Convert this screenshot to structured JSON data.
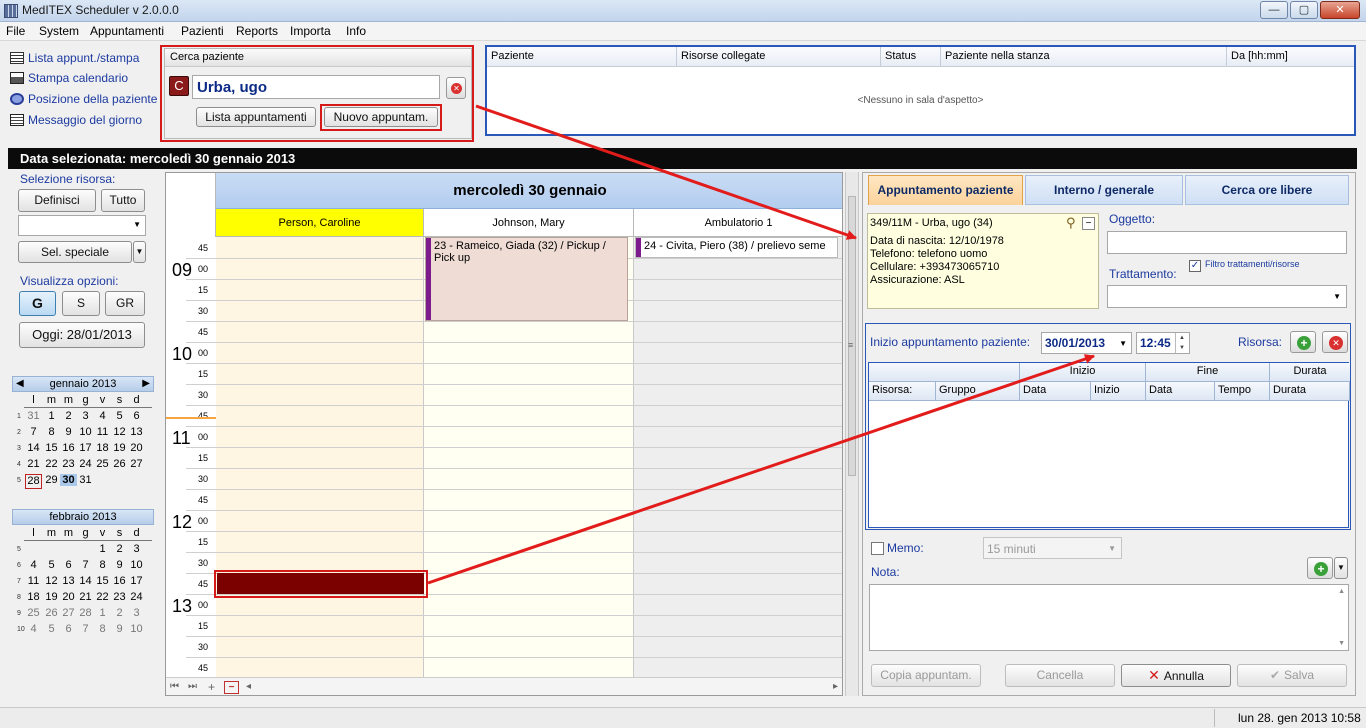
{
  "window": {
    "title": "MedITEX  Scheduler v 2.0.0.0",
    "min": "—",
    "max": "▢",
    "close": "✕"
  },
  "menu": [
    "File",
    "System",
    "Appuntamenti",
    "Pazienti",
    "Reports",
    "Importa",
    "Info"
  ],
  "quick_actions": [
    {
      "label": "Lista appunt./stampa",
      "icon": "list-icon"
    },
    {
      "label": "Stampa calendario",
      "icon": "printer-icon"
    },
    {
      "label": "Posizione della paziente",
      "icon": "position-icon"
    },
    {
      "label": "Messaggio del giorno",
      "icon": "message-icon"
    }
  ],
  "search": {
    "header": "Cerca paziente",
    "patient": "Urba, ugo",
    "btn_list": "Lista appuntamenti",
    "btn_new": "Nuovo appuntam."
  },
  "waiting": {
    "columns": [
      "Paziente",
      "Risorse collegate",
      "Status",
      "Paziente nella stanza",
      "Da [hh:mm]"
    ],
    "empty": "<Nessuno in sala d'aspetto>"
  },
  "date_banner": "Data selezionata: mercoledì 30 gennaio 2013",
  "left": {
    "selezione_risorsa": "Selezione risorsa:",
    "btn_definisci": "Definisci",
    "btn_tutto": "Tutto",
    "btn_sel_speciale": "Sel. speciale",
    "visualizza": "Visualizza opzioni:",
    "view_g": "G",
    "view_s": "S",
    "view_gr": "GR",
    "btn_oggi": "Oggi: 28/01/2013",
    "cal1": {
      "title": "gennaio 2013",
      "dow": [
        "l",
        "m",
        "m",
        "g",
        "v",
        "s",
        "d"
      ],
      "weeks": [
        {
          "wk": "1",
          "days": [
            "31",
            "1",
            "2",
            "3",
            "4",
            "5",
            "6"
          ]
        },
        {
          "wk": "2",
          "days": [
            "7",
            "8",
            "9",
            "10",
            "11",
            "12",
            "13"
          ]
        },
        {
          "wk": "3",
          "days": [
            "14",
            "15",
            "16",
            "17",
            "18",
            "19",
            "20"
          ]
        },
        {
          "wk": "4",
          "days": [
            "21",
            "22",
            "23",
            "24",
            "25",
            "26",
            "27"
          ]
        },
        {
          "wk": "5",
          "days": [
            "28",
            "29",
            "30",
            "31",
            "",
            "",
            ""
          ]
        }
      ]
    },
    "cal2": {
      "title": "febbraio 2013",
      "dow": [
        "l",
        "m",
        "m",
        "g",
        "v",
        "s",
        "d"
      ],
      "weeks": [
        {
          "wk": "5",
          "days": [
            "",
            "",
            "",
            "",
            "1",
            "2",
            "3"
          ]
        },
        {
          "wk": "6",
          "days": [
            "4",
            "5",
            "6",
            "7",
            "8",
            "9",
            "10"
          ]
        },
        {
          "wk": "7",
          "days": [
            "11",
            "12",
            "13",
            "14",
            "15",
            "16",
            "17"
          ]
        },
        {
          "wk": "8",
          "days": [
            "18",
            "19",
            "20",
            "21",
            "22",
            "23",
            "24"
          ]
        },
        {
          "wk": "9",
          "days": [
            "25",
            "26",
            "27",
            "28",
            "1",
            "2",
            "3"
          ]
        },
        {
          "wk": "10",
          "days": [
            "4",
            "5",
            "6",
            "7",
            "8",
            "9",
            "10"
          ]
        }
      ]
    }
  },
  "grid": {
    "day_title": "mercoledì 30 gennaio",
    "resources": [
      "Person, Caroline",
      "Johnson, Mary",
      "Ambulatorio 1"
    ],
    "hours": [
      "09",
      "10",
      "11",
      "12",
      "13"
    ],
    "mins": [
      "00",
      "15",
      "30",
      "45"
    ],
    "appts": [
      {
        "text": "23 - Rameico, Giada (32) / Pickup / Pick up"
      },
      {
        "text": "24 - Civita, Piero (38) / prelievo seme"
      }
    ]
  },
  "right": {
    "tabs": [
      "Appuntamento paziente",
      "Interno / generale",
      "Cerca ore libere"
    ],
    "patient_header": "349/11M - Urba, ugo (34)",
    "patient_lines": [
      "Data di nascita: 12/10/1978",
      "Telefono:  telefono uomo",
      "Cellulare: +393473065710",
      "Assicurazione: ASL"
    ],
    "oggetto": "Oggetto:",
    "trattamento": "Trattamento:",
    "filtro": "Filtro trattamenti/risorse",
    "inizio_label": "Inizio appuntamento paziente:",
    "inizio_date": "30/01/2013",
    "inizio_time": "12:45",
    "risorsa": "Risorsa:",
    "table_groups": [
      "Inizio",
      "Fine",
      "Durata"
    ],
    "table_cols": [
      "Risorsa:",
      "Gruppo",
      "Data",
      "Inizio",
      "Data",
      "Tempo",
      "Durata"
    ],
    "memo": "Memo:",
    "memo_select": "15 minuti",
    "nota": "Nota:",
    "btn_copia": "Copia appuntam.",
    "btn_cancella": "Cancella",
    "btn_annulla": "Annulla",
    "btn_salva": "Salva"
  },
  "status": {
    "datetime": "lun 28. gen 2013 10:58"
  },
  "colors": {
    "highlight": "#d61a1a",
    "selected_slot": "#7b0000",
    "caroline_header": "#ffff00"
  }
}
